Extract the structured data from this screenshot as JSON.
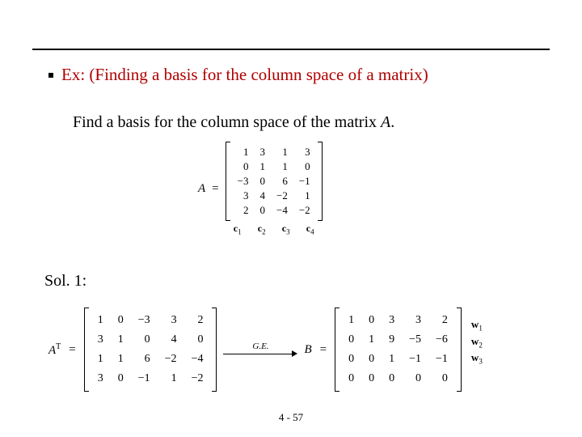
{
  "title": "Ex: (Finding a basis for the column space of a matrix)",
  "subline_prefix": "Find a basis for the column space of the matrix ",
  "subline_var": "A",
  "subline_suffix": ".",
  "lhs_A": "A",
  "eq_sign": "=",
  "matrix_A": {
    "rows": [
      [
        "1",
        "3",
        "1",
        "3"
      ],
      [
        "0",
        "1",
        "1",
        "0"
      ],
      [
        "−3",
        "0",
        "6",
        "−1"
      ],
      [
        "3",
        "4",
        "−2",
        "1"
      ],
      [
        "2",
        "0",
        "−4",
        "−2"
      ]
    ],
    "col_labels": [
      "c₁",
      "c₂",
      "c₃",
      "c₄"
    ]
  },
  "sol_label": "Sol. 1:",
  "lhs_AT_base": "A",
  "lhs_AT_sup": "T",
  "matrix_AT": {
    "rows": [
      [
        "1",
        "0",
        "−3",
        "3",
        "2"
      ],
      [
        "3",
        "1",
        "0",
        "4",
        "0"
      ],
      [
        "1",
        "1",
        "6",
        "−2",
        "−4"
      ],
      [
        "3",
        "0",
        "−1",
        "1",
        "−2"
      ]
    ]
  },
  "arrow_label": "G.E.",
  "lhs_B": "B",
  "matrix_B": {
    "rows": [
      [
        "1",
        "0",
        "3",
        "3",
        "2"
      ],
      [
        "0",
        "1",
        "9",
        "−5",
        "−6"
      ],
      [
        "0",
        "0",
        "1",
        "−1",
        "−1"
      ],
      [
        "0",
        "0",
        "0",
        "0",
        "0"
      ]
    ],
    "row_labels": [
      "w₁",
      "w₂",
      "w₃",
      ""
    ]
  },
  "page_num": "4 - 57",
  "chart_data": {
    "type": "table",
    "title": "Matrix A and its transpose reduced via Gaussian Elimination",
    "matrices": {
      "A": [
        [
          1,
          3,
          1,
          3
        ],
        [
          0,
          1,
          1,
          0
        ],
        [
          -3,
          0,
          6,
          -1
        ],
        [
          3,
          4,
          -2,
          1
        ],
        [
          2,
          0,
          -4,
          -2
        ]
      ],
      "A_transpose": [
        [
          1,
          0,
          -3,
          3,
          2
        ],
        [
          3,
          1,
          0,
          4,
          0
        ],
        [
          1,
          1,
          6,
          -2,
          -4
        ],
        [
          3,
          0,
          -1,
          1,
          -2
        ]
      ],
      "B_reduced": [
        [
          1,
          0,
          3,
          3,
          2
        ],
        [
          0,
          1,
          9,
          -5,
          -6
        ],
        [
          0,
          0,
          1,
          -1,
          -1
        ],
        [
          0,
          0,
          0,
          0,
          0
        ]
      ]
    },
    "column_labels_A": [
      "c1",
      "c2",
      "c3",
      "c4"
    ],
    "row_labels_B": [
      "w1",
      "w2",
      "w3",
      null
    ]
  }
}
